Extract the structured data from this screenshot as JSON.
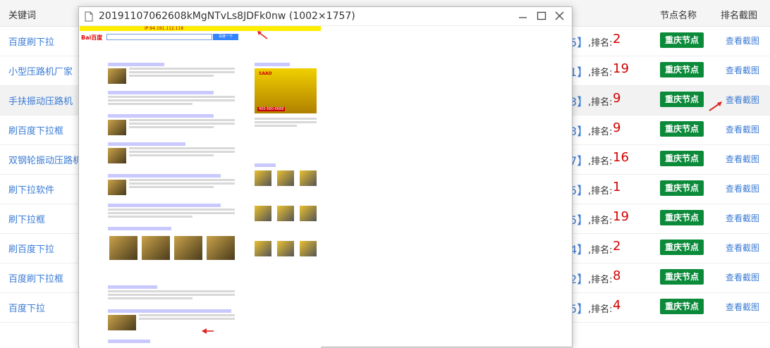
{
  "table": {
    "headers": {
      "keyword": "关键词",
      "node_name": "节点名称",
      "rank_screenshot": "排名截图"
    },
    "rank_label": ",排名:",
    "rows": [
      {
        "keyword": "百度刷下拉",
        "bracket": "5】",
        "rank": "2",
        "node": "重庆节点",
        "link": "查看截图"
      },
      {
        "keyword": "小型压路机厂家",
        "bracket": "1】",
        "rank": "19",
        "node": "重庆节点",
        "link": "查看截图"
      },
      {
        "keyword": "手扶振动压路机",
        "bracket": "3】",
        "rank": "9",
        "node": "重庆节点",
        "link": "查看截图"
      },
      {
        "keyword": "刷百度下拉框",
        "bracket": "3】",
        "rank": "9",
        "node": "重庆节点",
        "link": "查看截图"
      },
      {
        "keyword": "双钢轮振动压路机",
        "bracket": "7】",
        "rank": "16",
        "node": "重庆节点",
        "link": "查看截图"
      },
      {
        "keyword": "刷下拉软件",
        "bracket": "5】",
        "rank": "1",
        "node": "重庆节点",
        "link": "查看截图"
      },
      {
        "keyword": "刷下拉框",
        "bracket": "5】",
        "rank": "19",
        "node": "重庆节点",
        "link": "查看截图"
      },
      {
        "keyword": "刷百度下拉",
        "bracket": "4】",
        "rank": "2",
        "node": "重庆节点",
        "link": "查看截图"
      },
      {
        "keyword": "百度刷下拉框",
        "bracket": "2】",
        "rank": "8",
        "node": "重庆节点",
        "link": "查看截图"
      },
      {
        "keyword": "百度下拉",
        "bracket": "5】",
        "rank": "4",
        "node": "重庆节点",
        "link": "查看截图"
      }
    ]
  },
  "popup": {
    "title": "20191107062608kMgNTvLs8JDFk0nw (1002×1757)",
    "info_bar": "IP:94.191.112.118",
    "search_button": "百度一下",
    "logo": "Bai百度",
    "ad_text": "SAAD",
    "ad_phone": "400-680-6688",
    "colors": {
      "accent_green": "#0b8a3a",
      "rank_red": "#d40000",
      "link_blue": "#3a7bd5",
      "info_yellow": "#ffee00"
    }
  }
}
